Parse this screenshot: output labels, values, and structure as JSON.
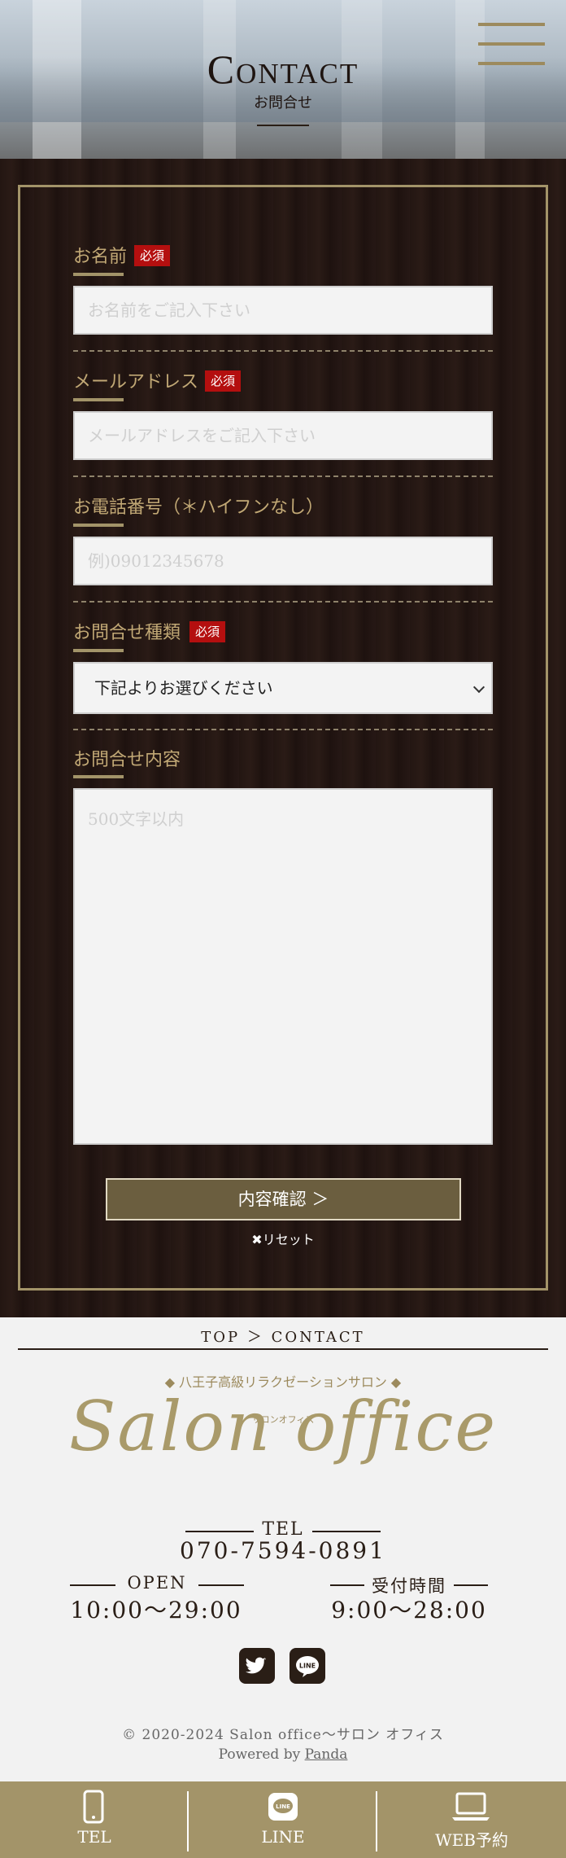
{
  "header": {
    "title": "Contact",
    "subtitle": "お問合せ",
    "menu_icon": "hamburger-menu-icon"
  },
  "form": {
    "name": {
      "label": "お名前",
      "required": "必須",
      "placeholder": "お名前をご記入下さい"
    },
    "email": {
      "label": "メールアドレス",
      "required": "必須",
      "placeholder": "メールアドレスをご記入下さい"
    },
    "phone": {
      "label": "お電話番号（＊ハイフンなし）",
      "placeholder": "例)09012345678"
    },
    "type": {
      "label": "お問合せ種類",
      "required": "必須",
      "selected": "下記よりお選びください"
    },
    "message": {
      "label": "お問合せ内容",
      "placeholder": "500文字以内"
    },
    "confirm_label": "内容確認 ＞",
    "reset_label": "✖リセット"
  },
  "footer": {
    "breadcrumb": "TOP ＞ CONTACT",
    "tagline": "◆ 八王子高級リラクゼーションサロン ◆",
    "logo_small": "サロンオフィス",
    "logo": "Salon office",
    "tel_label": "TEL",
    "tel_number": "070-7594-0891",
    "open_label": "OPEN",
    "open_hours": "10:00〜29:00",
    "reception_label": "受付時間",
    "reception_hours": "9:00〜28:00",
    "social": [
      "twitter-icon",
      "line-icon"
    ],
    "copyright": "© 2020-2024 Salon office〜サロン オフィス",
    "powered_prefix": "Powered by",
    "powered_link": "Panda"
  },
  "bottom_nav": {
    "items": [
      {
        "label": "TEL",
        "icon": "smartphone-icon"
      },
      {
        "label": "LINE",
        "icon": "line-icon"
      },
      {
        "label": "WEB予約",
        "icon": "laptop-icon"
      }
    ]
  },
  "colors": {
    "gold": "#a39469",
    "dark_brown": "#231612",
    "required_red": "#b40f0f",
    "button": "#6b5e3f"
  }
}
